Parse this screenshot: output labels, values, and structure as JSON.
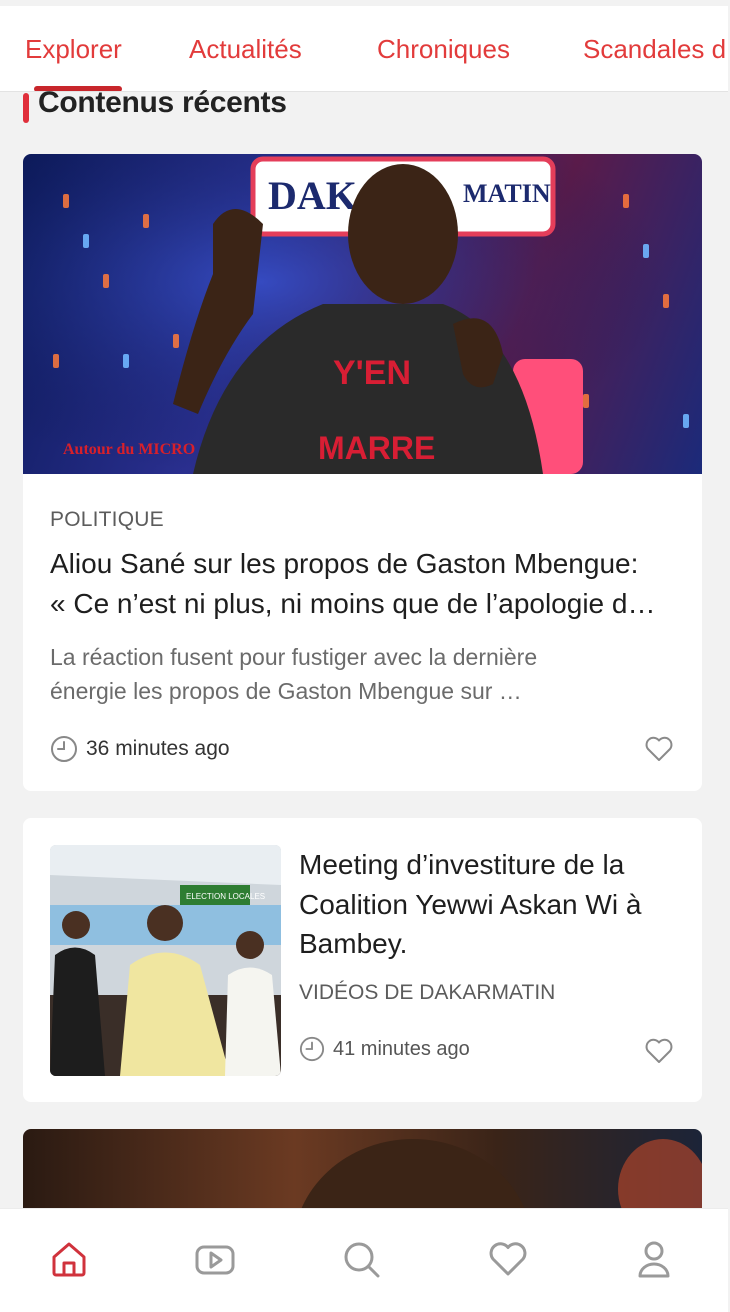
{
  "tabs": [
    {
      "label": "Explorer",
      "active": true
    },
    {
      "label": "Actualités",
      "active": false
    },
    {
      "label": "Chroniques",
      "active": false
    },
    {
      "label": "Scandales d",
      "active": false
    }
  ],
  "section": {
    "title": "Contenus récents"
  },
  "articles": [
    {
      "image_text": {
        "top": "DAKA",
        "top_right": "MATIN",
        "shirt_top": "Y'EN",
        "shirt_bottom": "MARRE",
        "logo": "Autour du MICRO"
      },
      "category": "POLITIQUE",
      "title_line1": "Aliou Sané sur les propos de Gaston Mbengue:",
      "title_line2": "« Ce n’est ni plus, ni moins que de l’apologie d…",
      "excerpt_line1": "La réaction fusent pour fustiger avec la dernière",
      "excerpt_line2": "énergie les propos de Gaston Mbengue sur …",
      "time": "36 minutes ago",
      "time_icon": "clock-icon",
      "like_icon": "heart-icon"
    },
    {
      "image_text": {
        "banner": "ELECTION LOCALES"
      },
      "title_line1": "Meeting d’investiture de la",
      "title_line2": "Coalition Yewwi Askan Wi  à",
      "title_line3": "Bambey.",
      "category": "VIDÉOS DE DAKARMATIN",
      "time": "41 minutes ago",
      "time_icon": "clock-icon",
      "like_icon": "heart-icon"
    }
  ],
  "bottom_nav": [
    {
      "icon": "home-icon",
      "active": true
    },
    {
      "icon": "play-icon",
      "active": false
    },
    {
      "icon": "search-icon",
      "active": false
    },
    {
      "icon": "heart-icon",
      "active": false
    },
    {
      "icon": "user-icon",
      "active": false
    }
  ],
  "colors": {
    "accent": "#e23b3b",
    "active_indicator": "#c8262b",
    "nav_inactive": "#9a9a9a",
    "background": "#f2f2f2"
  }
}
